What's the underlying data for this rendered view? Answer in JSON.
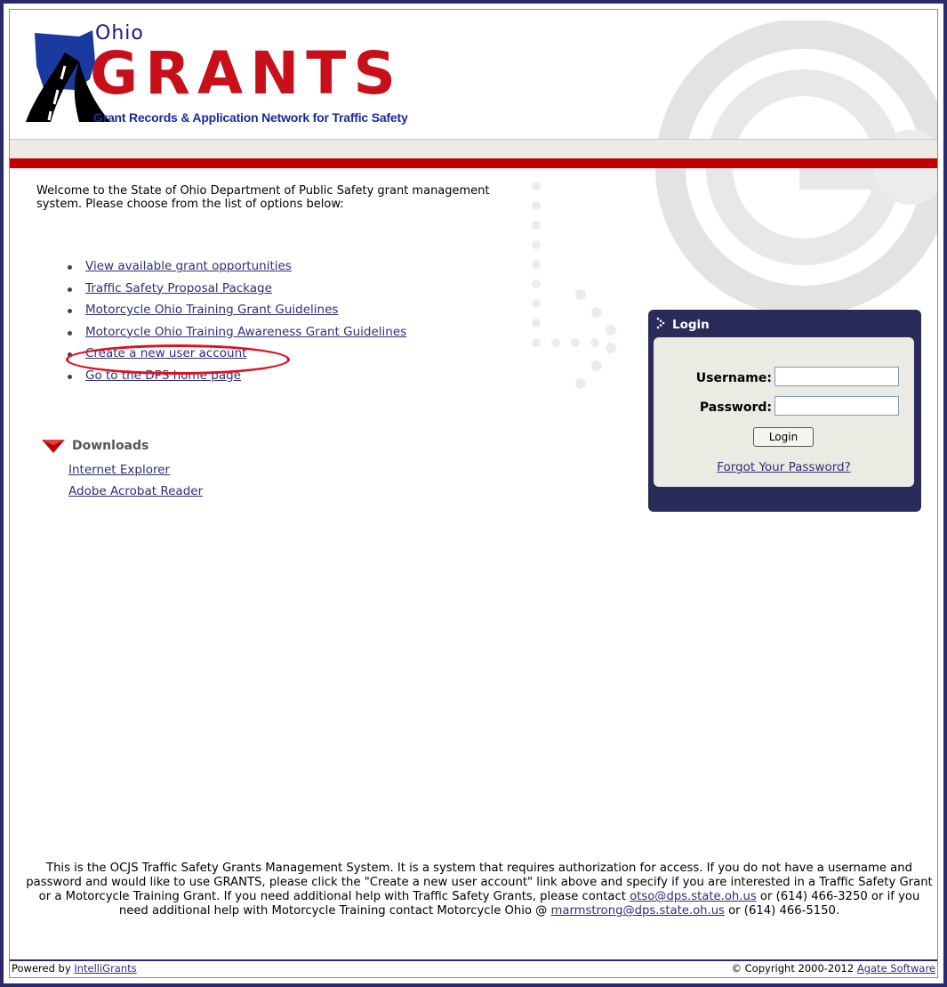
{
  "header": {
    "logo_ohio": "Ohio",
    "logo_grants": "GRANTS",
    "logo_tagline": "Grant Records & Application Network for Traffic Safety"
  },
  "welcome": {
    "text": "Welcome to the State of Ohio Department of Public Safety grant management system.  Please choose from the list of options below:"
  },
  "options": [
    {
      "label": "View available grant opportunities"
    },
    {
      "label": "Traffic Safety Proposal Package"
    },
    {
      "label": "Motorcycle Ohio Training Grant Guidelines"
    },
    {
      "label": "Motorcycle Ohio Training Awareness Grant Guidelines"
    },
    {
      "label": "Create a new user account"
    },
    {
      "label": "Go to the DPS home page"
    }
  ],
  "downloads": {
    "title": "Downloads",
    "links": [
      "Internet Explorer",
      "Adobe Acrobat Reader"
    ]
  },
  "login": {
    "title": "Login",
    "username_label": "Username:",
    "password_label": "Password:",
    "username_value": "",
    "password_value": "",
    "button_label": "Login",
    "forgot_label": "Forgot Your Password?"
  },
  "notice": {
    "part1": "This is the OCJS Traffic Safety Grants Management System. It is a system that requires authorization for access. If you do not have a username and password and would like to use GRANTS, please click the \"Create a new user account\" link above and specify if you are interested in a Traffic Safety Grant or a Motorcycle Training Grant. If you need additional help with Traffic Safety Grants, please contact ",
    "email1": "otso@dps.state.oh.us",
    "part2": " or (614) 466-3250 or if you need additional help with Motorcycle Training contact Motorcycle Ohio @ ",
    "email2": "marmstrong@dps.state.oh.us",
    "part3": " or (614) 466-5150."
  },
  "status_bar": {
    "powered_prefix": "Powered by ",
    "powered_link": "IntelliGrants",
    "copyright_prefix": "© Copyright 2000-2012 ",
    "copyright_link": "Agate Software"
  },
  "colors": {
    "brand_red": "#c00000",
    "navy": "#2b2b5a",
    "link": "#2e2e7a",
    "highlight_red": "#e01020"
  }
}
